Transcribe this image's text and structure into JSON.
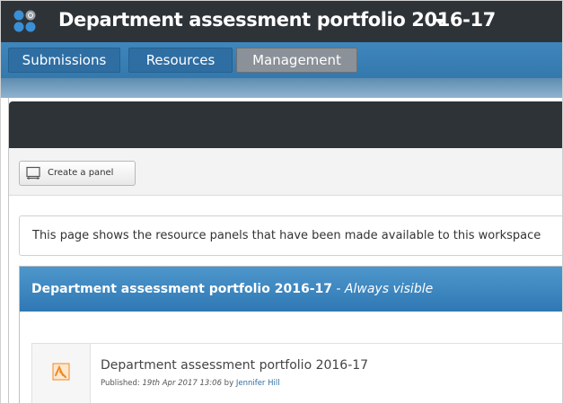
{
  "header": {
    "title": "Department assessment portfolio 2016-17",
    "logo_icon": "app-logo-icon",
    "caret_icon": "caret-down-icon"
  },
  "nav": {
    "tabs": [
      {
        "label": "Submissions",
        "active": false
      },
      {
        "label": "Resources",
        "active": false
      },
      {
        "label": "Management",
        "active": true
      }
    ]
  },
  "toolbar": {
    "create_panel_label": "Create a panel",
    "create_panel_icon": "panel-icon"
  },
  "info": {
    "text": "This page shows the resource panels that have been made available to this workspace"
  },
  "panel": {
    "title": "Department assessment portfolio 2016-17",
    "visibility": " - Always visible",
    "items": [
      {
        "icon": "resource-file-icon",
        "name": "Department assessment portfolio 2016-17",
        "published_label": "Published: ",
        "published_date": "19th Apr 2017 13:06",
        "by_label": " by ",
        "author": "Jennifer Hill"
      }
    ]
  },
  "colors": {
    "header_bg": "#2e3338",
    "nav_bg": "#3379ad",
    "active_tab": "#8a9198",
    "panel_head": "#3a85c0",
    "resource_icon": "#f08a24"
  }
}
